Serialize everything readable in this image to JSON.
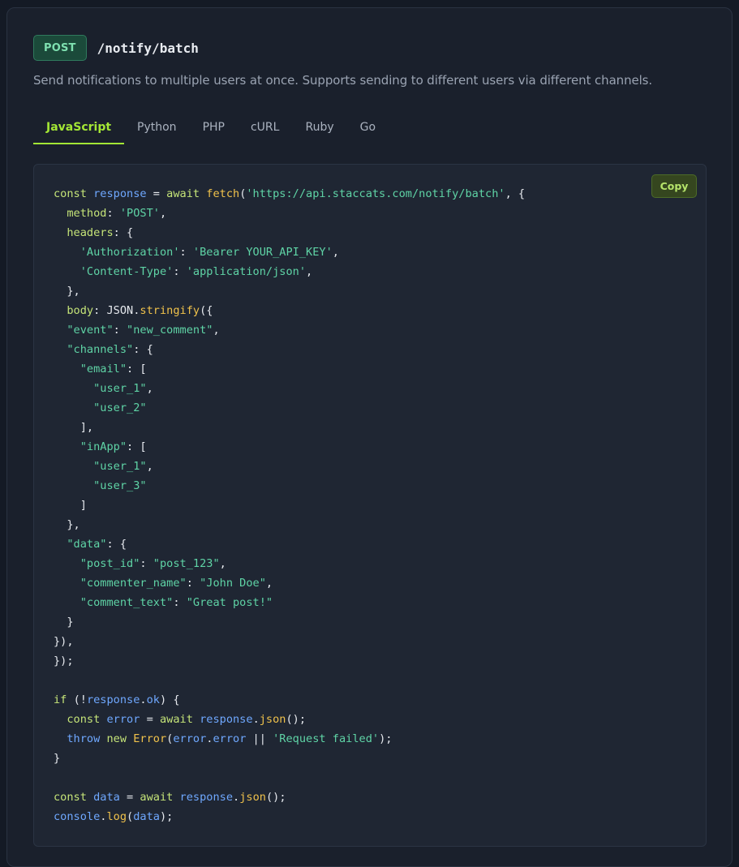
{
  "endpoint": {
    "method": "POST",
    "path": "/notify/batch",
    "description": "Send notifications to multiple users at once. Supports sending to different users via different channels."
  },
  "tabs": [
    {
      "label": "JavaScript",
      "active": true
    },
    {
      "label": "Python",
      "active": false
    },
    {
      "label": "PHP",
      "active": false
    },
    {
      "label": "cURL",
      "active": false
    },
    {
      "label": "Ruby",
      "active": false
    },
    {
      "label": "Go",
      "active": false
    }
  ],
  "code_block": {
    "copy_label": "Copy",
    "language": "JavaScript",
    "lines": [
      [
        [
          "kw",
          "const "
        ],
        [
          "id",
          "response"
        ],
        [
          "pl",
          " = "
        ],
        [
          "kw",
          "await "
        ],
        [
          "fn",
          "fetch"
        ],
        [
          "pl",
          "("
        ],
        [
          "str",
          "'https://api.staccats.com/notify/batch'"
        ],
        [
          "pl",
          ", {"
        ]
      ],
      [
        [
          "pl",
          "  "
        ],
        [
          "pr",
          "method"
        ],
        [
          "pl",
          ": "
        ],
        [
          "str",
          "'POST'"
        ],
        [
          "pl",
          ","
        ]
      ],
      [
        [
          "pl",
          "  "
        ],
        [
          "pr",
          "headers"
        ],
        [
          "pl",
          ": {"
        ]
      ],
      [
        [
          "pl",
          "    "
        ],
        [
          "str",
          "'Authorization'"
        ],
        [
          "pl",
          ": "
        ],
        [
          "str",
          "'Bearer YOUR_API_KEY'"
        ],
        [
          "pl",
          ","
        ]
      ],
      [
        [
          "pl",
          "    "
        ],
        [
          "str",
          "'Content-Type'"
        ],
        [
          "pl",
          ": "
        ],
        [
          "str",
          "'application/json'"
        ],
        [
          "pl",
          ","
        ]
      ],
      [
        [
          "pl",
          "  },"
        ]
      ],
      [
        [
          "pl",
          "  "
        ],
        [
          "pr",
          "body"
        ],
        [
          "pl",
          ": JSON."
        ],
        [
          "fn",
          "stringify"
        ],
        [
          "pl",
          "({"
        ]
      ],
      [
        [
          "pl",
          "  "
        ],
        [
          "str",
          "\"event\""
        ],
        [
          "pl",
          ": "
        ],
        [
          "str",
          "\"new_comment\""
        ],
        [
          "pl",
          ","
        ]
      ],
      [
        [
          "pl",
          "  "
        ],
        [
          "str",
          "\"channels\""
        ],
        [
          "pl",
          ": {"
        ]
      ],
      [
        [
          "pl",
          "    "
        ],
        [
          "str",
          "\"email\""
        ],
        [
          "pl",
          ": ["
        ]
      ],
      [
        [
          "pl",
          "      "
        ],
        [
          "str",
          "\"user_1\""
        ],
        [
          "pl",
          ","
        ]
      ],
      [
        [
          "pl",
          "      "
        ],
        [
          "str",
          "\"user_2\""
        ]
      ],
      [
        [
          "pl",
          "    ],"
        ]
      ],
      [
        [
          "pl",
          "    "
        ],
        [
          "str",
          "\"inApp\""
        ],
        [
          "pl",
          ": ["
        ]
      ],
      [
        [
          "pl",
          "      "
        ],
        [
          "str",
          "\"user_1\""
        ],
        [
          "pl",
          ","
        ]
      ],
      [
        [
          "pl",
          "      "
        ],
        [
          "str",
          "\"user_3\""
        ]
      ],
      [
        [
          "pl",
          "    ]"
        ]
      ],
      [
        [
          "pl",
          "  },"
        ]
      ],
      [
        [
          "pl",
          "  "
        ],
        [
          "str",
          "\"data\""
        ],
        [
          "pl",
          ": {"
        ]
      ],
      [
        [
          "pl",
          "    "
        ],
        [
          "str",
          "\"post_id\""
        ],
        [
          "pl",
          ": "
        ],
        [
          "str",
          "\"post_123\""
        ],
        [
          "pl",
          ","
        ]
      ],
      [
        [
          "pl",
          "    "
        ],
        [
          "str",
          "\"commenter_name\""
        ],
        [
          "pl",
          ": "
        ],
        [
          "str",
          "\"John Doe\""
        ],
        [
          "pl",
          ","
        ]
      ],
      [
        [
          "pl",
          "    "
        ],
        [
          "str",
          "\"comment_text\""
        ],
        [
          "pl",
          ": "
        ],
        [
          "str",
          "\"Great post!\""
        ]
      ],
      [
        [
          "pl",
          "  }"
        ]
      ],
      [
        [
          "pl",
          "}),"
        ]
      ],
      [
        [
          "pl",
          "});"
        ]
      ],
      [],
      [
        [
          "kw",
          "if "
        ],
        [
          "pl",
          "(!"
        ],
        [
          "id",
          "response"
        ],
        [
          "pl",
          "."
        ],
        [
          "id",
          "ok"
        ],
        [
          "pl",
          ") {"
        ]
      ],
      [
        [
          "pl",
          "  "
        ],
        [
          "kw",
          "const "
        ],
        [
          "id",
          "error"
        ],
        [
          "pl",
          " = "
        ],
        [
          "kw",
          "await "
        ],
        [
          "id",
          "response"
        ],
        [
          "pl",
          "."
        ],
        [
          "fn",
          "json"
        ],
        [
          "pl",
          "();"
        ]
      ],
      [
        [
          "pl",
          "  "
        ],
        [
          "id",
          "throw "
        ],
        [
          "kw",
          "new "
        ],
        [
          "fn",
          "Error"
        ],
        [
          "pl",
          "("
        ],
        [
          "id",
          "error"
        ],
        [
          "pl",
          "."
        ],
        [
          "id",
          "error"
        ],
        [
          "pl",
          " || "
        ],
        [
          "str",
          "'Request failed'"
        ],
        [
          "pl",
          ");"
        ]
      ],
      [
        [
          "pl",
          "}"
        ]
      ],
      [],
      [
        [
          "kw",
          "const "
        ],
        [
          "id",
          "data"
        ],
        [
          "pl",
          " = "
        ],
        [
          "kw",
          "await "
        ],
        [
          "id",
          "response"
        ],
        [
          "pl",
          "."
        ],
        [
          "fn",
          "json"
        ],
        [
          "pl",
          "();"
        ]
      ],
      [
        [
          "id",
          "console"
        ],
        [
          "pl",
          "."
        ],
        [
          "fn",
          "log"
        ],
        [
          "pl",
          "("
        ],
        [
          "id",
          "data"
        ],
        [
          "pl",
          ");"
        ]
      ]
    ]
  }
}
